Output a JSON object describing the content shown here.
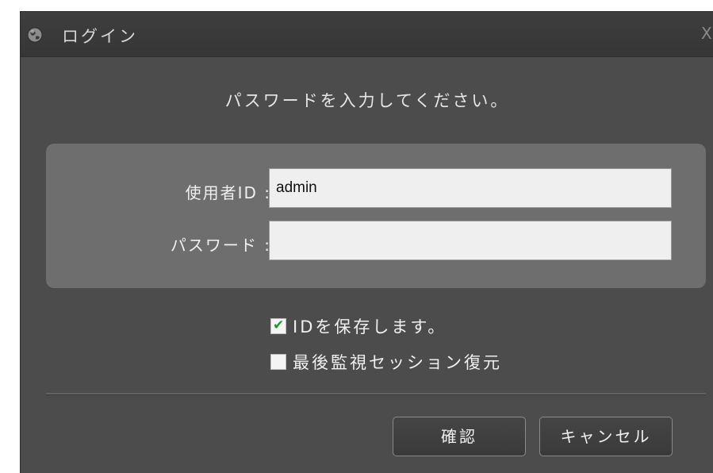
{
  "window": {
    "title": "ログイン",
    "close_label": "X"
  },
  "prompt": "パスワードを入力してください。",
  "form": {
    "user_id_label": "使用者ID :",
    "user_id_value": "admin",
    "password_label": "パスワード :",
    "password_value": ""
  },
  "options": {
    "save_id": {
      "label": "IDを保存します。",
      "checked": true
    },
    "restore_session": {
      "label": "最後監視セッション復元",
      "checked": false
    }
  },
  "buttons": {
    "ok_label": "確認",
    "cancel_label": "キャンセル"
  },
  "colors": {
    "dialog_bg": "#4c4c4c",
    "panel_bg": "#6e6e6e",
    "check_green": "#1f9a2c"
  },
  "icons": {
    "app": "globe-icon",
    "check": "checkmark-icon"
  }
}
